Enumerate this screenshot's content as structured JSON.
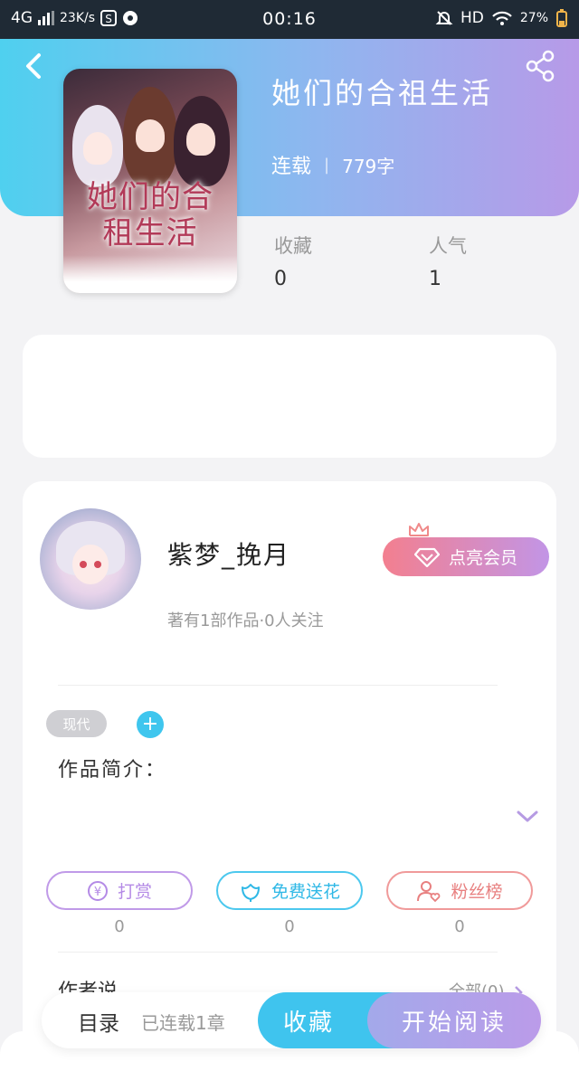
{
  "status_bar": {
    "network": "4G",
    "speed": "23K/s",
    "time": "00:16",
    "hd": "HD",
    "battery": "27%"
  },
  "book": {
    "title": "她们的合祖生活",
    "status": "连载",
    "word_count": "779字",
    "cover_title_line1": "她们的合",
    "cover_title_line2": "租生活"
  },
  "stats": {
    "collect_label": "收藏",
    "collect_value": "0",
    "popularity_label": "人气",
    "popularity_value": "1"
  },
  "author": {
    "name": "紫梦_挽月",
    "summary": "著有1部作品·0人关注",
    "vip_button": "点亮会员"
  },
  "tags": {
    "items": [
      "现代"
    ],
    "add_symbol": "+"
  },
  "intro": {
    "label": "作品简介："
  },
  "actions": [
    {
      "label": "打赏",
      "count": "0",
      "icon": "yen-coin-icon",
      "color": "#b48ae6"
    },
    {
      "label": "免费送花",
      "count": "0",
      "icon": "flower-icon",
      "color": "#3fc4ee"
    },
    {
      "label": "粉丝榜",
      "count": "0",
      "icon": "user-heart-icon",
      "color": "#f08a8a"
    }
  ],
  "author_say": {
    "label": "作者说",
    "all_link": "全部(0)"
  },
  "bottom_bar": {
    "toc_label": "目录",
    "toc_sub": "已连载1章",
    "collect_button": "收藏",
    "read_button": "开始阅读"
  },
  "colors": {
    "accent_blue": "#3fc4ee",
    "accent_purple": "#b79ae8",
    "vip_gradient_start": "#f37f8f"
  }
}
